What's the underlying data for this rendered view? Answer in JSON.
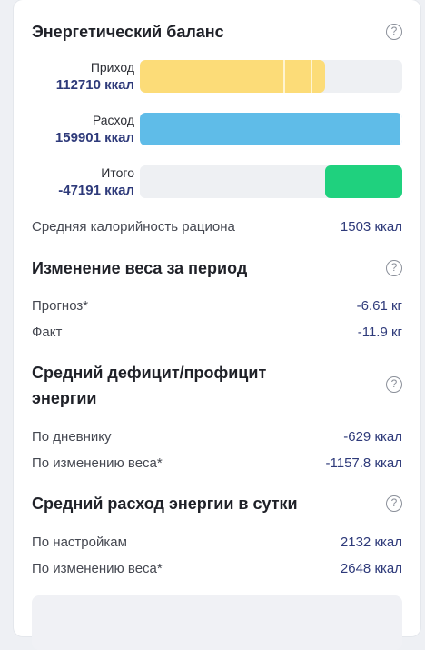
{
  "energy_balance": {
    "title": "Энергетический баланс",
    "help": "?",
    "bars": {
      "income": {
        "label": "Приход",
        "value": "112710 ккал",
        "fraction": 0.705,
        "color": "#fcdc78"
      },
      "expense": {
        "label": "Расход",
        "value": "159901 ккал",
        "fraction": 1.0,
        "color": "#5fbce8"
      },
      "total": {
        "label": "Итого",
        "value": "-47191 ккал",
        "fraction": 0.295,
        "color": "#1fd17e"
      }
    },
    "avg_calorie": {
      "label": "Средняя калорийность рациона",
      "value": "1503 ккал"
    }
  },
  "weight_change": {
    "title": "Изменение веса за период",
    "help": "?",
    "forecast": {
      "label": "Прогноз*",
      "value": "-6.61 кг"
    },
    "fact": {
      "label": "Факт",
      "value": "-11.9 кг"
    }
  },
  "deficit": {
    "title_line1": "Средний дефицит/профицит",
    "title_line2": "энергии",
    "help": "?",
    "by_diary": {
      "label": "По дневнику",
      "value": "-629 ккал"
    },
    "by_weight": {
      "label": "По изменению веса*",
      "value": "-1157.8 ккал"
    }
  },
  "daily_expense": {
    "title": "Средний расход энергии в сутки",
    "help": "?",
    "by_settings": {
      "label": "По настройкам",
      "value": "2132 ккал"
    },
    "by_weight": {
      "label": "По изменению веса*",
      "value": "2648 ккал"
    }
  }
}
